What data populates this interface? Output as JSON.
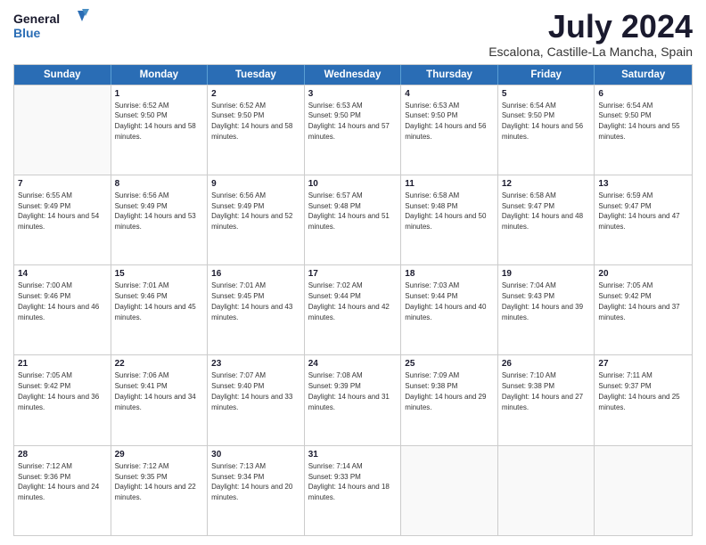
{
  "logo": {
    "line1": "General",
    "line2": "Blue"
  },
  "title": "July 2024",
  "subtitle": "Escalona, Castille-La Mancha, Spain",
  "weekdays": [
    "Sunday",
    "Monday",
    "Tuesday",
    "Wednesday",
    "Thursday",
    "Friday",
    "Saturday"
  ],
  "weeks": [
    [
      {
        "day": "",
        "sunrise": "",
        "sunset": "",
        "daylight": ""
      },
      {
        "day": "1",
        "sunrise": "Sunrise: 6:52 AM",
        "sunset": "Sunset: 9:50 PM",
        "daylight": "Daylight: 14 hours and 58 minutes."
      },
      {
        "day": "2",
        "sunrise": "Sunrise: 6:52 AM",
        "sunset": "Sunset: 9:50 PM",
        "daylight": "Daylight: 14 hours and 58 minutes."
      },
      {
        "day": "3",
        "sunrise": "Sunrise: 6:53 AM",
        "sunset": "Sunset: 9:50 PM",
        "daylight": "Daylight: 14 hours and 57 minutes."
      },
      {
        "day": "4",
        "sunrise": "Sunrise: 6:53 AM",
        "sunset": "Sunset: 9:50 PM",
        "daylight": "Daylight: 14 hours and 56 minutes."
      },
      {
        "day": "5",
        "sunrise": "Sunrise: 6:54 AM",
        "sunset": "Sunset: 9:50 PM",
        "daylight": "Daylight: 14 hours and 56 minutes."
      },
      {
        "day": "6",
        "sunrise": "Sunrise: 6:54 AM",
        "sunset": "Sunset: 9:50 PM",
        "daylight": "Daylight: 14 hours and 55 minutes."
      }
    ],
    [
      {
        "day": "7",
        "sunrise": "Sunrise: 6:55 AM",
        "sunset": "Sunset: 9:49 PM",
        "daylight": "Daylight: 14 hours and 54 minutes."
      },
      {
        "day": "8",
        "sunrise": "Sunrise: 6:56 AM",
        "sunset": "Sunset: 9:49 PM",
        "daylight": "Daylight: 14 hours and 53 minutes."
      },
      {
        "day": "9",
        "sunrise": "Sunrise: 6:56 AM",
        "sunset": "Sunset: 9:49 PM",
        "daylight": "Daylight: 14 hours and 52 minutes."
      },
      {
        "day": "10",
        "sunrise": "Sunrise: 6:57 AM",
        "sunset": "Sunset: 9:48 PM",
        "daylight": "Daylight: 14 hours and 51 minutes."
      },
      {
        "day": "11",
        "sunrise": "Sunrise: 6:58 AM",
        "sunset": "Sunset: 9:48 PM",
        "daylight": "Daylight: 14 hours and 50 minutes."
      },
      {
        "day": "12",
        "sunrise": "Sunrise: 6:58 AM",
        "sunset": "Sunset: 9:47 PM",
        "daylight": "Daylight: 14 hours and 48 minutes."
      },
      {
        "day": "13",
        "sunrise": "Sunrise: 6:59 AM",
        "sunset": "Sunset: 9:47 PM",
        "daylight": "Daylight: 14 hours and 47 minutes."
      }
    ],
    [
      {
        "day": "14",
        "sunrise": "Sunrise: 7:00 AM",
        "sunset": "Sunset: 9:46 PM",
        "daylight": "Daylight: 14 hours and 46 minutes."
      },
      {
        "day": "15",
        "sunrise": "Sunrise: 7:01 AM",
        "sunset": "Sunset: 9:46 PM",
        "daylight": "Daylight: 14 hours and 45 minutes."
      },
      {
        "day": "16",
        "sunrise": "Sunrise: 7:01 AM",
        "sunset": "Sunset: 9:45 PM",
        "daylight": "Daylight: 14 hours and 43 minutes."
      },
      {
        "day": "17",
        "sunrise": "Sunrise: 7:02 AM",
        "sunset": "Sunset: 9:44 PM",
        "daylight": "Daylight: 14 hours and 42 minutes."
      },
      {
        "day": "18",
        "sunrise": "Sunrise: 7:03 AM",
        "sunset": "Sunset: 9:44 PM",
        "daylight": "Daylight: 14 hours and 40 minutes."
      },
      {
        "day": "19",
        "sunrise": "Sunrise: 7:04 AM",
        "sunset": "Sunset: 9:43 PM",
        "daylight": "Daylight: 14 hours and 39 minutes."
      },
      {
        "day": "20",
        "sunrise": "Sunrise: 7:05 AM",
        "sunset": "Sunset: 9:42 PM",
        "daylight": "Daylight: 14 hours and 37 minutes."
      }
    ],
    [
      {
        "day": "21",
        "sunrise": "Sunrise: 7:05 AM",
        "sunset": "Sunset: 9:42 PM",
        "daylight": "Daylight: 14 hours and 36 minutes."
      },
      {
        "day": "22",
        "sunrise": "Sunrise: 7:06 AM",
        "sunset": "Sunset: 9:41 PM",
        "daylight": "Daylight: 14 hours and 34 minutes."
      },
      {
        "day": "23",
        "sunrise": "Sunrise: 7:07 AM",
        "sunset": "Sunset: 9:40 PM",
        "daylight": "Daylight: 14 hours and 33 minutes."
      },
      {
        "day": "24",
        "sunrise": "Sunrise: 7:08 AM",
        "sunset": "Sunset: 9:39 PM",
        "daylight": "Daylight: 14 hours and 31 minutes."
      },
      {
        "day": "25",
        "sunrise": "Sunrise: 7:09 AM",
        "sunset": "Sunset: 9:38 PM",
        "daylight": "Daylight: 14 hours and 29 minutes."
      },
      {
        "day": "26",
        "sunrise": "Sunrise: 7:10 AM",
        "sunset": "Sunset: 9:38 PM",
        "daylight": "Daylight: 14 hours and 27 minutes."
      },
      {
        "day": "27",
        "sunrise": "Sunrise: 7:11 AM",
        "sunset": "Sunset: 9:37 PM",
        "daylight": "Daylight: 14 hours and 25 minutes."
      }
    ],
    [
      {
        "day": "28",
        "sunrise": "Sunrise: 7:12 AM",
        "sunset": "Sunset: 9:36 PM",
        "daylight": "Daylight: 14 hours and 24 minutes."
      },
      {
        "day": "29",
        "sunrise": "Sunrise: 7:12 AM",
        "sunset": "Sunset: 9:35 PM",
        "daylight": "Daylight: 14 hours and 22 minutes."
      },
      {
        "day": "30",
        "sunrise": "Sunrise: 7:13 AM",
        "sunset": "Sunset: 9:34 PM",
        "daylight": "Daylight: 14 hours and 20 minutes."
      },
      {
        "day": "31",
        "sunrise": "Sunrise: 7:14 AM",
        "sunset": "Sunset: 9:33 PM",
        "daylight": "Daylight: 14 hours and 18 minutes."
      },
      {
        "day": "",
        "sunrise": "",
        "sunset": "",
        "daylight": ""
      },
      {
        "day": "",
        "sunrise": "",
        "sunset": "",
        "daylight": ""
      },
      {
        "day": "",
        "sunrise": "",
        "sunset": "",
        "daylight": ""
      }
    ]
  ]
}
